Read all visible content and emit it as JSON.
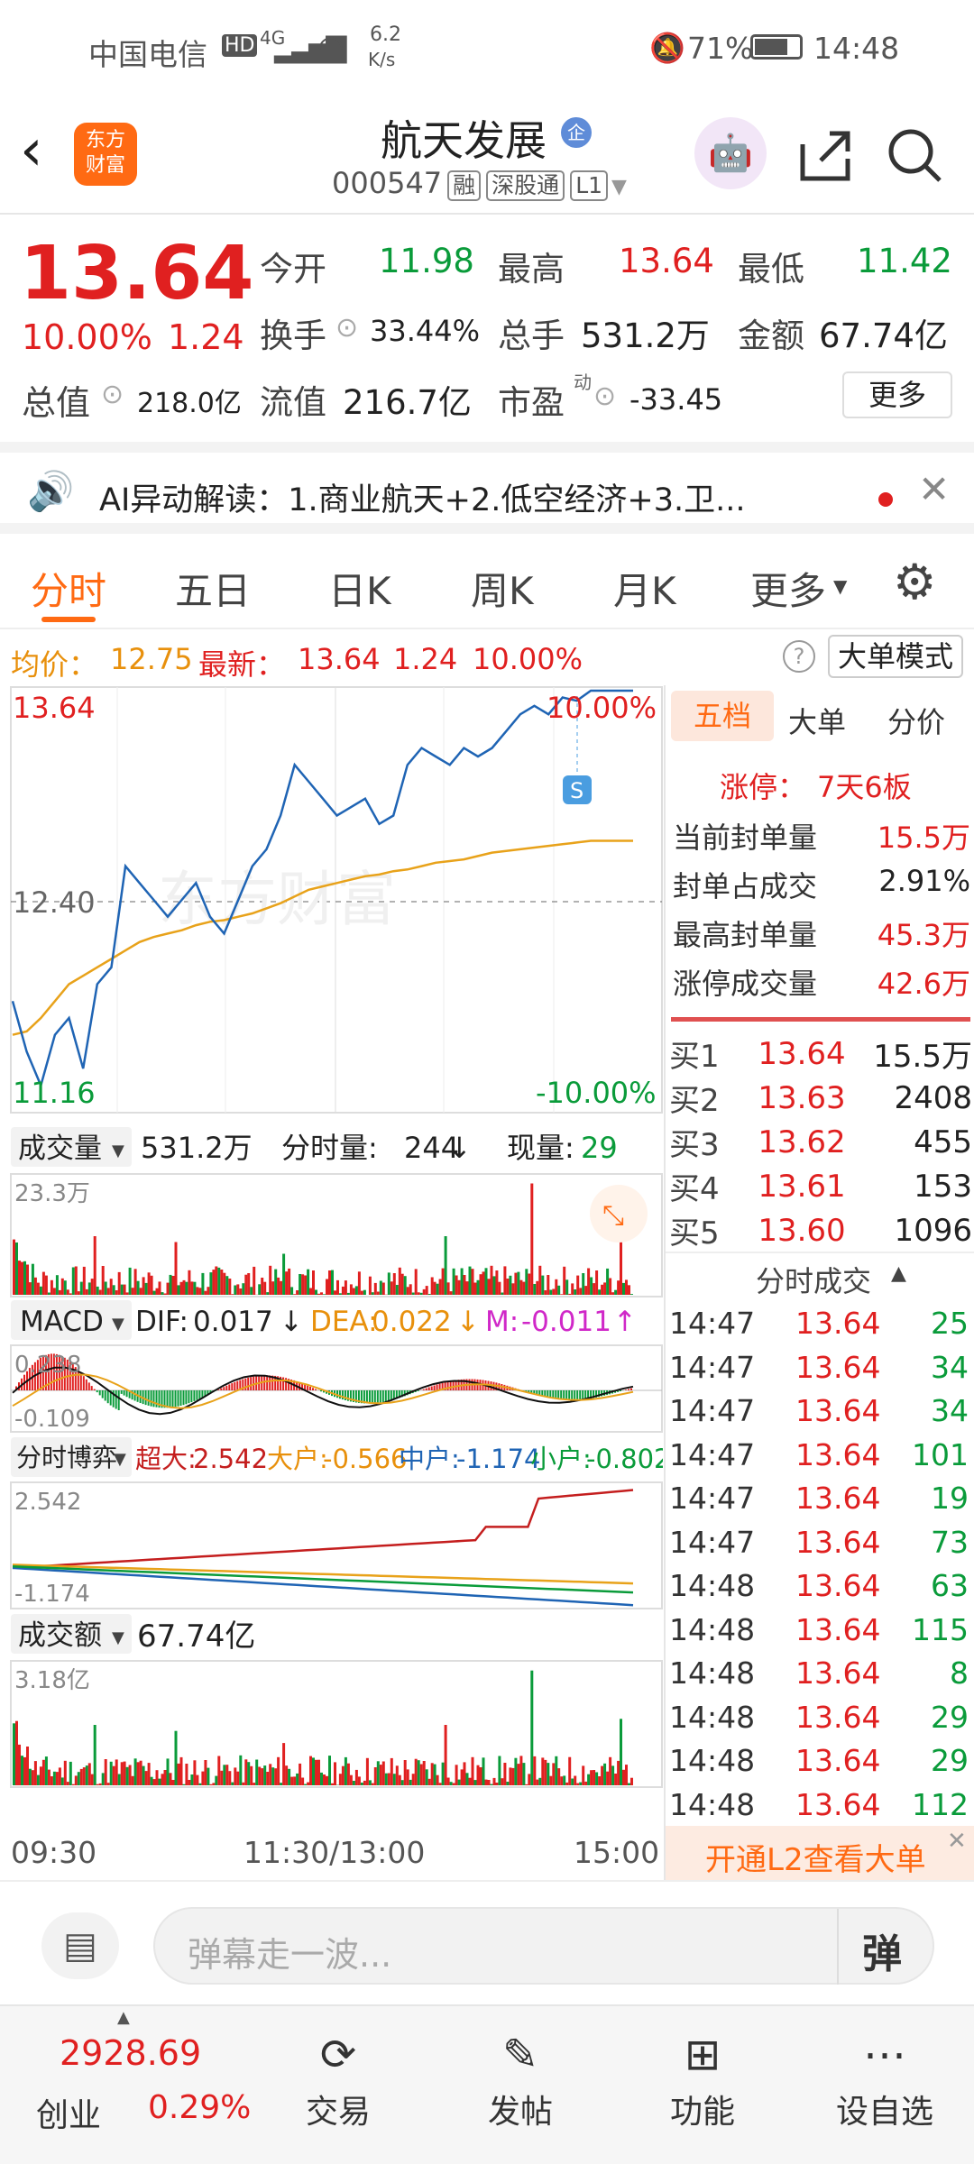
{
  "status": {
    "carrier": "中国电信",
    "hd": "HD",
    "net": "4G",
    "speed": "6.2",
    "speed_unit": "K/s",
    "battery": "71%",
    "time": "14:48"
  },
  "header": {
    "name": "航天发展",
    "badge": "企",
    "code": "000547",
    "tags": [
      "融",
      "深股通",
      "L1"
    ]
  },
  "quote": {
    "price": "13.64",
    "pct": "10.00%",
    "chg": "1.24",
    "open_l": "今开",
    "open": "11.98",
    "high_l": "最高",
    "high": "13.64",
    "low_l": "最低",
    "low": "11.42",
    "turn_l": "换手",
    "turn": "33.44%",
    "vol_l": "总手",
    "vol": "531.2万",
    "amt_l": "金额",
    "amt": "67.74亿",
    "cap_l": "总值",
    "cap": "218.0亿",
    "float_l": "流值",
    "float": "216.7亿",
    "pe_l": "市盈",
    "pe_sup": "动",
    "pe": "-33.45",
    "more": "更多"
  },
  "ai": {
    "text": "AI异动解读：1.商业航天+2.低空经济+3.卫..."
  },
  "tabs": [
    "分时",
    "五日",
    "日K",
    "周K",
    "月K",
    "更多"
  ],
  "info": {
    "avg_l": "均价：",
    "avg": "12.75",
    "last_l": "最新：",
    "last": "13.64",
    "chg": "1.24",
    "pct": "10.00%",
    "mode": "大单模式"
  },
  "chart": {
    "top": "13.64",
    "top_pct": "10.00%",
    "mid": "12.40",
    "bot": "11.16",
    "bot_pct": "-10.00%",
    "watermark": "东方财富",
    "s": "S"
  },
  "vol": {
    "label": "成交量",
    "total": "531.2万",
    "fs_l": "分时量:",
    "fs": "244",
    "fs_arrow": "↓",
    "cur_l": "现量:",
    "cur": "29",
    "ymax": "23.3万"
  },
  "macd": {
    "label": "MACD",
    "dif_l": "DIF:",
    "dif": "0.017",
    "dif_a": "↓",
    "dea_l": "DEA:",
    "dea": "0.022",
    "dea_a": "↓",
    "m_l": "M:",
    "m": "-0.011",
    "m_a": "↑",
    "ymax": "0.238",
    "ymin": "-0.109"
  },
  "game": {
    "label": "分时博弈",
    "cd_l": "超大:",
    "cd": "2.542",
    "dh_l": "大户:",
    "dh": "-0.566",
    "zh_l": "中户:",
    "zh": "-1.174",
    "xh_l": "小户:",
    "xh": "-0.802",
    "ymax": "2.542",
    "ymin": "-1.174"
  },
  "amt": {
    "label": "成交额",
    "total": "67.74亿",
    "ymax": "3.18亿"
  },
  "xaxis": [
    "09:30",
    "11:30/13:00",
    "15:00"
  ],
  "right": {
    "tabs": [
      "五档",
      "大单",
      "分价"
    ],
    "limit_l": "涨停：",
    "limit": "7天6板",
    "stats": [
      {
        "l": "当前封单量",
        "v": "15.5万"
      },
      {
        "l": "封单占成交",
        "v": "2.91%"
      },
      {
        "l": "最高封单量",
        "v": "45.3万"
      },
      {
        "l": "涨停成交量",
        "v": "42.6万"
      }
    ],
    "book": [
      {
        "l": "买1",
        "p": "13.64",
        "v": "15.5万"
      },
      {
        "l": "买2",
        "p": "13.63",
        "v": "2408"
      },
      {
        "l": "买3",
        "p": "13.62",
        "v": "455"
      },
      {
        "l": "买4",
        "p": "13.61",
        "v": "153"
      },
      {
        "l": "买5",
        "p": "13.60",
        "v": "1096"
      }
    ],
    "trades_title": "分时成交",
    "trades": [
      {
        "t": "14:47",
        "p": "13.64",
        "v": "25"
      },
      {
        "t": "14:47",
        "p": "13.64",
        "v": "34"
      },
      {
        "t": "14:47",
        "p": "13.64",
        "v": "34"
      },
      {
        "t": "14:47",
        "p": "13.64",
        "v": "101"
      },
      {
        "t": "14:47",
        "p": "13.64",
        "v": "19"
      },
      {
        "t": "14:47",
        "p": "13.64",
        "v": "73"
      },
      {
        "t": "14:48",
        "p": "13.64",
        "v": "63"
      },
      {
        "t": "14:48",
        "p": "13.64",
        "v": "115"
      },
      {
        "t": "14:48",
        "p": "13.64",
        "v": "8"
      },
      {
        "t": "14:48",
        "p": "13.64",
        "v": "29"
      },
      {
        "t": "14:48",
        "p": "13.64",
        "v": "29"
      },
      {
        "t": "14:48",
        "p": "13.64",
        "v": "112"
      }
    ],
    "l2": "开通L2查看大单"
  },
  "input": {
    "placeholder": "弹幕走一波..."
  },
  "nav": {
    "index": "2928.69",
    "index_name": "创业",
    "index_pct": "0.29%",
    "items": [
      "交易",
      "发帖",
      "功能",
      "设自选"
    ]
  },
  "colors": {
    "up": "#e02020",
    "down": "#0a9b3a",
    "price_line": "#1f64b4",
    "avg_line": "#e8a21a",
    "brand": "#ff6a13"
  }
}
